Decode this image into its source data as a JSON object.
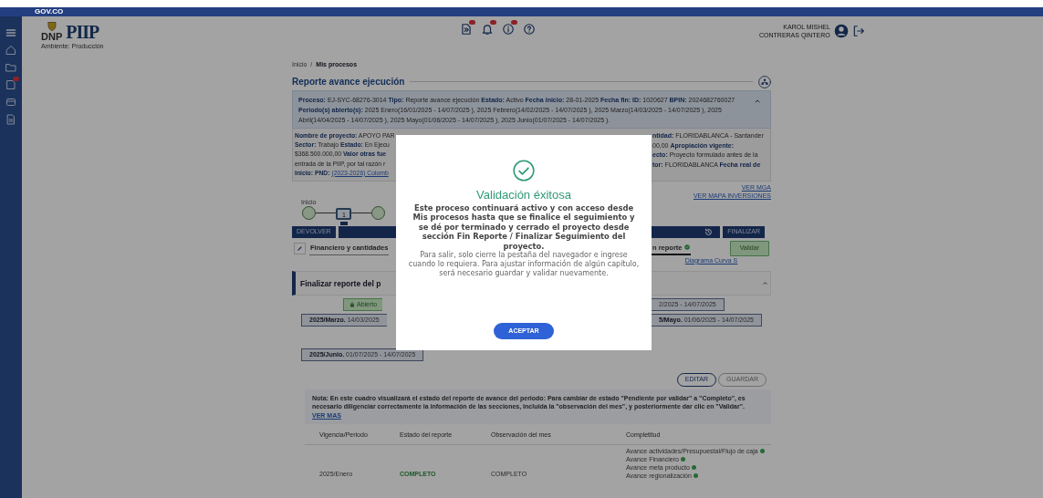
{
  "gov_bar": {
    "logo_text": "GOV.CO"
  },
  "header": {
    "logo_text": "DNP",
    "app_logo": "PIIP",
    "environment": "Ambiente: Producción",
    "user": {
      "name_line1": "KAROL MISHEL",
      "name_line2": "CONTRERAS QINTERO"
    }
  },
  "breadcrumb": {
    "separator": "/",
    "items": [
      {
        "label": "Inicio",
        "selected": false
      },
      {
        "label": "Mis procesos",
        "selected": true
      }
    ]
  },
  "page_title": "Reporte avance ejecución",
  "process_info": {
    "expanded": true,
    "text": "**Proceso:** EJ-SYC-68276-3014 **Tipo:** Reporte avance ejecución **Estado:** Activo **Fecha inicio:** 28-01-2025 **Fecha fin:** **ID:** 1020627 **BPIN:** 2024682760027 **Periodo(s) abierto(s):** 2025 Enero(16/01/2025 - 14/07/2025 ), 2025 Febrero(14/02/2025 - 14/07/2025 ), 2025 Marzo(14/03/2025 - 14/07/2025 ), 2025 Abril(14/04/2025 - 14/07/2025 ), 2025 Mayo(01/06/2025 - 14/07/2025 ), 2025 Junio(01/07/2025 - 14/07/2025 )."
  },
  "project_details": {
    "left_lines": [
      {
        "text": "**Nombre de proyecto:** APOYO PAR"
      },
      {
        "text": "**Sector:** Trabajo **Estado:** En Ejecu"
      },
      {
        "text": "$368.500.000,00 **Valor otras fue**"
      },
      {
        "text": "entrada de la PIIP, por tal razón r"
      },
      {
        "text": "**Inicio: PND:**",
        "link": "(2023-2026) Colomb"
      }
    ],
    "right_lines": [
      {
        "text": "**ntidad:** FLORIDABLANCA - Santander"
      },
      {
        "text": "00,00 **Apropiación vigente:**"
      },
      {
        "text": "**ecto:** Proyecto formulado antes de la"
      },
      {
        "text": "**tor:** FLORIDABLANCA **Fecha real de**"
      }
    ]
  },
  "links": [
    "VER MGA",
    "VER MAPA INVERSIONES"
  ],
  "stepper": {
    "steps": [
      {
        "kind": "start",
        "label": "Inicio",
        "current": false
      },
      {
        "kind": "step",
        "label": "1",
        "current": true
      },
      {
        "kind": "end",
        "current": false
      }
    ]
  },
  "action_bar": {
    "return_button": "DEVOLVER",
    "finish_button": "FINALIZAR"
  },
  "tabs": [
    {
      "label": "Financiero y cantidades",
      "selected": false,
      "complete": false
    },
    {
      "label": "n reporte",
      "selected": true,
      "complete": true
    }
  ],
  "validate_button": "Validar",
  "curve_link": "Diagrama Curva S",
  "finalize_section": {
    "title": "Finalizar reporte del p",
    "expanded": true,
    "rows": [
      {
        "left": {
          "kind": "status",
          "text": "Abierto"
        },
        "right": {
          "kind": "period",
          "text": "2/2025 - 14/07/2025"
        }
      },
      {
        "left": {
          "kind": "period",
          "text": "**2025/Marzo.** 14/03/2025"
        },
        "right": {
          "kind": "period",
          "text": "**5/Mayo.** 01/06/2025 - 14/07/2025"
        }
      },
      {
        "left": {
          "kind": "period",
          "text": "**2025/Junio.** 01/07/2025 - 14/07/2025"
        }
      }
    ]
  },
  "table_buttons": [
    {
      "label": "EDITAR",
      "disabled": false
    },
    {
      "label": "GUARDAR",
      "disabled": true
    }
  ],
  "note": {
    "text": "Nota: En este cuadro visualizará el estado del reporte de avance del periodo: Para cambiar de estado \"Pendiente por validar\" a \"Completo\", es necesario diligenciar correctamente la información de las secciones, incluida la \"observación del mes\", y posteriormente dar clic en \"Validar\".",
    "link": "VER MAS"
  },
  "table": {
    "columns": [
      "Vigencia/Periodo",
      "Estado del reporte",
      "Observación del mes",
      "Completitud"
    ],
    "rows": [
      {
        "period": "2025/Enero",
        "status": "COMPLETO",
        "observation": "COMPLETO",
        "completeness": [
          {
            "label": "Avance actividades/Presupuestal/Flujo de caja",
            "done": true
          },
          {
            "label": "Avance Financiero",
            "done": true
          },
          {
            "label": "Avance meta producto",
            "done": true
          },
          {
            "label": "Avance regionalización",
            "done": true
          }
        ]
      }
    ]
  },
  "modal": {
    "title": "Validación éxitosa",
    "message": "Este proceso continuará activo y con acceso desde Mis procesos hasta que se finalice el seguimiento y se dé por terminado y cerrado el proyecto desde sección Fin Reporte / Finalizar Seguimiento del proyecto.",
    "note": "Para salir, solo cierre la pestaña del navegador e ingrese cuando lo requiera. Para ajustar información de algún capítulo, será necesario guardar y validar nuevamente.",
    "button": "ACEPTAR"
  }
}
